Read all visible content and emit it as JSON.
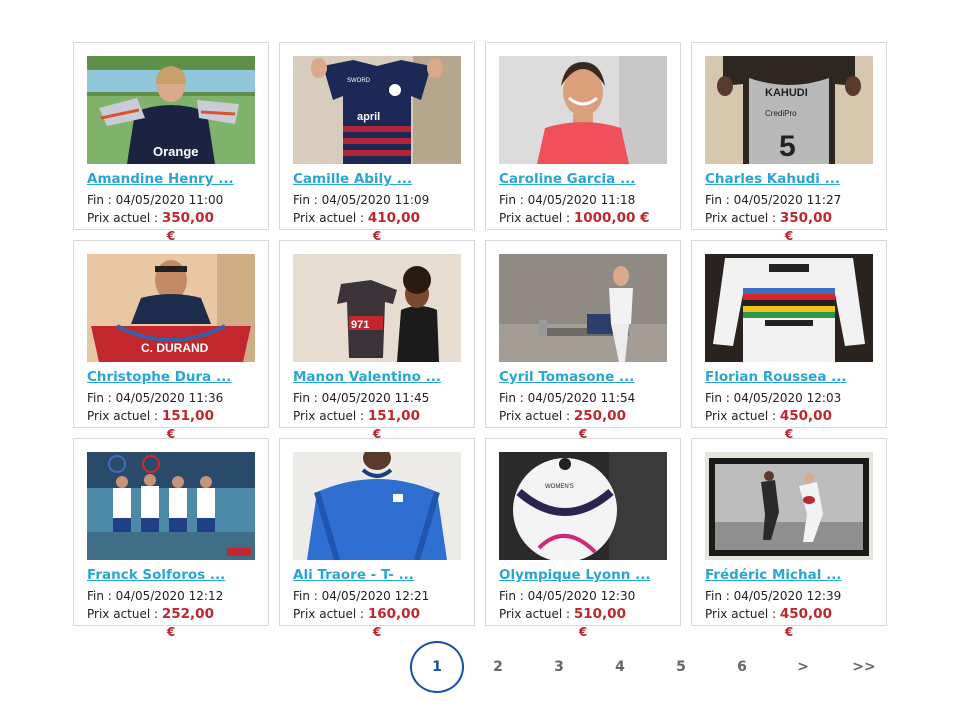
{
  "labels": {
    "end_prefix": "Fin :",
    "price_prefix": "Prix actuel :",
    "currency": "€"
  },
  "lots": [
    {
      "title": " Amandine Henry ...",
      "end": "04/05/2020 11:00",
      "price": "350,00",
      "currency_inline": "",
      "currency_below": "€",
      "image": "player-holding-boots-photo"
    },
    {
      "title": " Camille Abily  ...",
      "end": "04/05/2020 11:09",
      "price": "410,00",
      "currency_inline": "",
      "currency_below": "€",
      "image": "lyon-jersey-photo"
    },
    {
      "title": "Caroline Garcia ...",
      "end": "04/05/2020 11:18",
      "price": "1000,00",
      "currency_inline": "€",
      "currency_below": "",
      "image": "tennis-player-portrait-photo"
    },
    {
      "title": "Charles Kahudi  ...",
      "end": "04/05/2020 11:27",
      "price": "350,00",
      "currency_inline": "",
      "currency_below": "€",
      "image": "basketball-jersey-photo"
    },
    {
      "title": "Christophe Dura ...",
      "end": "04/05/2020 11:36",
      "price": "151,00",
      "currency_inline": "",
      "currency_below": "€",
      "image": "durand-shirt-photo"
    },
    {
      "title": "Manon Valentino ...",
      "end": "04/05/2020 11:45",
      "price": "151,00",
      "currency_inline": "",
      "currency_below": "€",
      "image": "cycling-jersey-photo"
    },
    {
      "title": "Cyril Tomasone  ...",
      "end": "04/05/2020 11:54",
      "price": "250,00",
      "currency_inline": "",
      "currency_below": "€",
      "image": "gymnast-photo"
    },
    {
      "title": "Florian Roussea ...",
      "end": "04/05/2020 12:03",
      "price": "450,00",
      "currency_inline": "",
      "currency_below": "€",
      "image": "rainbow-jersey-photo"
    },
    {
      "title": "Franck Solforos ...",
      "end": "04/05/2020 12:12",
      "price": "252,00",
      "currency_inline": "",
      "currency_below": "€",
      "image": "rowing-team-photo"
    },
    {
      "title": "Ali Traore - T- ...",
      "end": "04/05/2020 12:21",
      "price": "160,00",
      "currency_inline": "",
      "currency_below": "€",
      "image": "blue-france-shirt-photo"
    },
    {
      "title": "Olympique Lyonn ...",
      "end": "04/05/2020 12:30",
      "price": "510,00",
      "currency_inline": "",
      "currency_below": "€",
      "image": "champions-league-ball-photo"
    },
    {
      "title": "Frédéric Michal ...",
      "end": "04/05/2020 12:39",
      "price": "450,00",
      "currency_inline": "",
      "currency_below": "€",
      "image": "framed-rugby-photo"
    }
  ],
  "pagination": {
    "pages": [
      "1",
      "2",
      "3",
      "4",
      "5",
      "6",
      ">",
      ">>"
    ],
    "current": "1"
  },
  "colors": {
    "link": "#29a6d6",
    "price": "#c0272d",
    "active_page": "#1a4fa8"
  }
}
